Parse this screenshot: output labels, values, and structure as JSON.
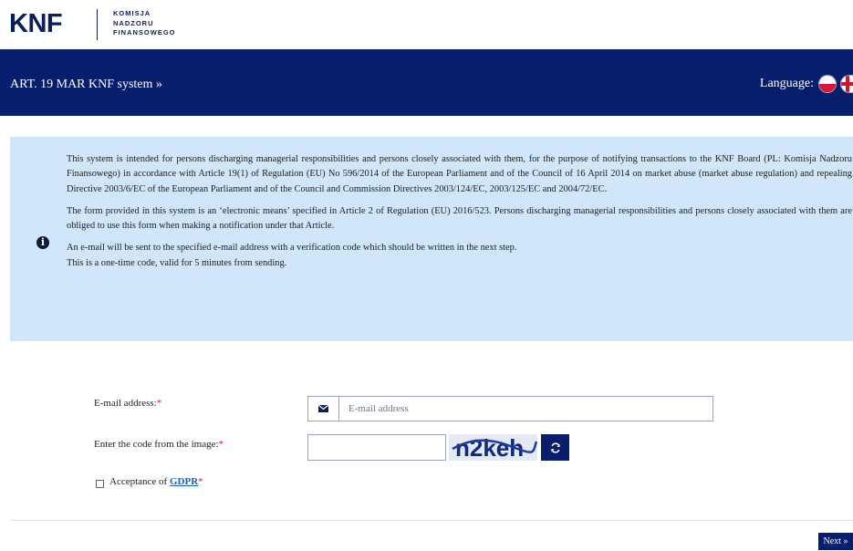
{
  "logo": {
    "brand": "KNF",
    "line1": "KOMISJA",
    "line2": "NADZORU",
    "line3": "FINANSOWEGO"
  },
  "nav": {
    "title": "ART. 19 MAR KNF system »",
    "language_label": "Language:",
    "languages": [
      "Polish",
      "English"
    ]
  },
  "info": {
    "paragraph1": "This system is intended for persons discharging managerial responsibilities and persons closely associated with them, for the purpose of notifying transactions to the KNF Board (PL: Komisja Nadzoru Finansowego) in accordance with Article 19(1) of Regulation (EU) No 596/2014 of the European Parliament and of the Council of 16 April 2014 on market abuse (market abuse regulation) and repealing Directive 2003/6/EC of the European Parliament and of the Council and Commission Directives 2003/124/EC, 2003/125/EC and 2004/72/EC.",
    "paragraph2": "The form provided in this system is an ‘electronic means’ specified in Article 2 of Regulation (EU) 2016/523. Persons discharging managerial responsibilities and persons closely associated with them are obliged to use this form when making a notification under that Article.",
    "paragraph3a": "An e-mail will be sent to the specified e-mail address with a verification code which should be written in the next step.",
    "paragraph3b": "This is a one-time code, valid for 5 minutes from sending."
  },
  "form": {
    "email_label": "E-mail address:",
    "email_placeholder": "E-mail address",
    "email_value": "",
    "code_label": "Enter the code from the image:",
    "code_value": "",
    "captcha_text": "n2keh",
    "required_mark": "*",
    "gdpr_prefix": "Acceptance of ",
    "gdpr_link": "GDPR",
    "gdpr_checked": false
  },
  "actions": {
    "next_label": "Next »"
  },
  "colors": {
    "navy": "#061e6b",
    "info_bg": "#cfe6fb",
    "required": "#d11a1a",
    "link": "#1f5fbf"
  }
}
